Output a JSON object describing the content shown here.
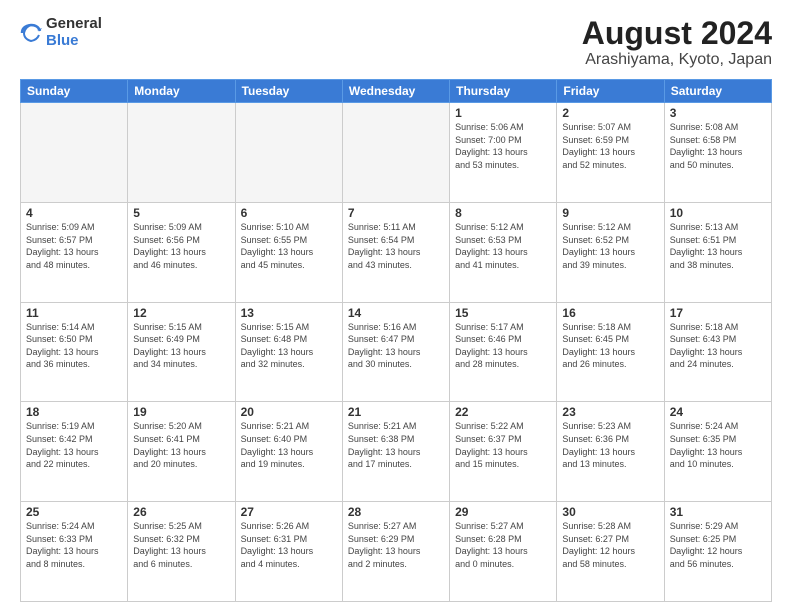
{
  "header": {
    "logo_general": "General",
    "logo_blue": "Blue",
    "title": "August 2024",
    "subtitle": "Arashiyama, Kyoto, Japan"
  },
  "weekdays": [
    "Sunday",
    "Monday",
    "Tuesday",
    "Wednesday",
    "Thursday",
    "Friday",
    "Saturday"
  ],
  "weeks": [
    [
      {
        "day": "",
        "info": ""
      },
      {
        "day": "",
        "info": ""
      },
      {
        "day": "",
        "info": ""
      },
      {
        "day": "",
        "info": ""
      },
      {
        "day": "1",
        "info": "Sunrise: 5:06 AM\nSunset: 7:00 PM\nDaylight: 13 hours\nand 53 minutes."
      },
      {
        "day": "2",
        "info": "Sunrise: 5:07 AM\nSunset: 6:59 PM\nDaylight: 13 hours\nand 52 minutes."
      },
      {
        "day": "3",
        "info": "Sunrise: 5:08 AM\nSunset: 6:58 PM\nDaylight: 13 hours\nand 50 minutes."
      }
    ],
    [
      {
        "day": "4",
        "info": "Sunrise: 5:09 AM\nSunset: 6:57 PM\nDaylight: 13 hours\nand 48 minutes."
      },
      {
        "day": "5",
        "info": "Sunrise: 5:09 AM\nSunset: 6:56 PM\nDaylight: 13 hours\nand 46 minutes."
      },
      {
        "day": "6",
        "info": "Sunrise: 5:10 AM\nSunset: 6:55 PM\nDaylight: 13 hours\nand 45 minutes."
      },
      {
        "day": "7",
        "info": "Sunrise: 5:11 AM\nSunset: 6:54 PM\nDaylight: 13 hours\nand 43 minutes."
      },
      {
        "day": "8",
        "info": "Sunrise: 5:12 AM\nSunset: 6:53 PM\nDaylight: 13 hours\nand 41 minutes."
      },
      {
        "day": "9",
        "info": "Sunrise: 5:12 AM\nSunset: 6:52 PM\nDaylight: 13 hours\nand 39 minutes."
      },
      {
        "day": "10",
        "info": "Sunrise: 5:13 AM\nSunset: 6:51 PM\nDaylight: 13 hours\nand 38 minutes."
      }
    ],
    [
      {
        "day": "11",
        "info": "Sunrise: 5:14 AM\nSunset: 6:50 PM\nDaylight: 13 hours\nand 36 minutes."
      },
      {
        "day": "12",
        "info": "Sunrise: 5:15 AM\nSunset: 6:49 PM\nDaylight: 13 hours\nand 34 minutes."
      },
      {
        "day": "13",
        "info": "Sunrise: 5:15 AM\nSunset: 6:48 PM\nDaylight: 13 hours\nand 32 minutes."
      },
      {
        "day": "14",
        "info": "Sunrise: 5:16 AM\nSunset: 6:47 PM\nDaylight: 13 hours\nand 30 minutes."
      },
      {
        "day": "15",
        "info": "Sunrise: 5:17 AM\nSunset: 6:46 PM\nDaylight: 13 hours\nand 28 minutes."
      },
      {
        "day": "16",
        "info": "Sunrise: 5:18 AM\nSunset: 6:45 PM\nDaylight: 13 hours\nand 26 minutes."
      },
      {
        "day": "17",
        "info": "Sunrise: 5:18 AM\nSunset: 6:43 PM\nDaylight: 13 hours\nand 24 minutes."
      }
    ],
    [
      {
        "day": "18",
        "info": "Sunrise: 5:19 AM\nSunset: 6:42 PM\nDaylight: 13 hours\nand 22 minutes."
      },
      {
        "day": "19",
        "info": "Sunrise: 5:20 AM\nSunset: 6:41 PM\nDaylight: 13 hours\nand 20 minutes."
      },
      {
        "day": "20",
        "info": "Sunrise: 5:21 AM\nSunset: 6:40 PM\nDaylight: 13 hours\nand 19 minutes."
      },
      {
        "day": "21",
        "info": "Sunrise: 5:21 AM\nSunset: 6:38 PM\nDaylight: 13 hours\nand 17 minutes."
      },
      {
        "day": "22",
        "info": "Sunrise: 5:22 AM\nSunset: 6:37 PM\nDaylight: 13 hours\nand 15 minutes."
      },
      {
        "day": "23",
        "info": "Sunrise: 5:23 AM\nSunset: 6:36 PM\nDaylight: 13 hours\nand 13 minutes."
      },
      {
        "day": "24",
        "info": "Sunrise: 5:24 AM\nSunset: 6:35 PM\nDaylight: 13 hours\nand 10 minutes."
      }
    ],
    [
      {
        "day": "25",
        "info": "Sunrise: 5:24 AM\nSunset: 6:33 PM\nDaylight: 13 hours\nand 8 minutes."
      },
      {
        "day": "26",
        "info": "Sunrise: 5:25 AM\nSunset: 6:32 PM\nDaylight: 13 hours\nand 6 minutes."
      },
      {
        "day": "27",
        "info": "Sunrise: 5:26 AM\nSunset: 6:31 PM\nDaylight: 13 hours\nand 4 minutes."
      },
      {
        "day": "28",
        "info": "Sunrise: 5:27 AM\nSunset: 6:29 PM\nDaylight: 13 hours\nand 2 minutes."
      },
      {
        "day": "29",
        "info": "Sunrise: 5:27 AM\nSunset: 6:28 PM\nDaylight: 13 hours\nand 0 minutes."
      },
      {
        "day": "30",
        "info": "Sunrise: 5:28 AM\nSunset: 6:27 PM\nDaylight: 12 hours\nand 58 minutes."
      },
      {
        "day": "31",
        "info": "Sunrise: 5:29 AM\nSunset: 6:25 PM\nDaylight: 12 hours\nand 56 minutes."
      }
    ]
  ]
}
